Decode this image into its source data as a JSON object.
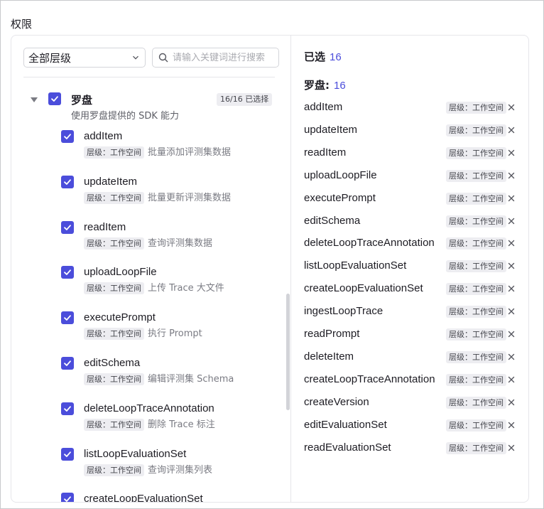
{
  "section_title": "权限",
  "filter": {
    "level_select": "全部层级",
    "search_placeholder": "请输入关键词进行搜索"
  },
  "group": {
    "name": "罗盘",
    "description": "使用罗盘提供的 SDK 能力",
    "badge": "16/16 已选择"
  },
  "items": [
    {
      "name": "addItem",
      "level": "层级：工作空间",
      "desc": "批量添加评测集数据"
    },
    {
      "name": "updateItem",
      "level": "层级：工作空间",
      "desc": "批量更新评测集数据"
    },
    {
      "name": "readItem",
      "level": "层级：工作空间",
      "desc": "查询评测集数据"
    },
    {
      "name": "uploadLoopFile",
      "level": "层级：工作空间",
      "desc": "上传 Trace 大文件"
    },
    {
      "name": "executePrompt",
      "level": "层级：工作空间",
      "desc": "执行 Prompt"
    },
    {
      "name": "editSchema",
      "level": "层级：工作空间",
      "desc": "编辑评测集 Schema"
    },
    {
      "name": "deleteLoopTraceAnnotation",
      "level": "层级：工作空间",
      "desc": "删除 Trace 标注"
    },
    {
      "name": "listLoopEvaluationSet",
      "level": "层级：工作空间",
      "desc": "查询评测集列表"
    },
    {
      "name": "createLoopEvaluationSet",
      "level": "",
      "desc": ""
    }
  ],
  "selected": {
    "title": "已选",
    "count": "16",
    "group_title": "罗盘:",
    "group_count": "16",
    "items": [
      {
        "name": "addItem",
        "level": "层级：工作空间"
      },
      {
        "name": "updateItem",
        "level": "层级：工作空间"
      },
      {
        "name": "readItem",
        "level": "层级：工作空间"
      },
      {
        "name": "uploadLoopFile",
        "level": "层级：工作空间"
      },
      {
        "name": "executePrompt",
        "level": "层级：工作空间"
      },
      {
        "name": "editSchema",
        "level": "层级：工作空间"
      },
      {
        "name": "deleteLoopTraceAnnotation",
        "level": "层级：工作空间"
      },
      {
        "name": "listLoopEvaluationSet",
        "level": "层级：工作空间"
      },
      {
        "name": "createLoopEvaluationSet",
        "level": "层级：工作空间"
      },
      {
        "name": "ingestLoopTrace",
        "level": "层级：工作空间"
      },
      {
        "name": "readPrompt",
        "level": "层级：工作空间"
      },
      {
        "name": "deleteItem",
        "level": "层级：工作空间"
      },
      {
        "name": "createLoopTraceAnnotation",
        "level": "层级：工作空间"
      },
      {
        "name": "createVersion",
        "level": "层级：工作空间"
      },
      {
        "name": "editEvaluationSet",
        "level": "层级：工作空间"
      },
      {
        "name": "readEvaluationSet",
        "level": "层级：工作空间"
      }
    ]
  },
  "colors": {
    "accent": "#4b4ddb",
    "tag_bg": "#ededf1",
    "border": "#e6e6ea"
  }
}
